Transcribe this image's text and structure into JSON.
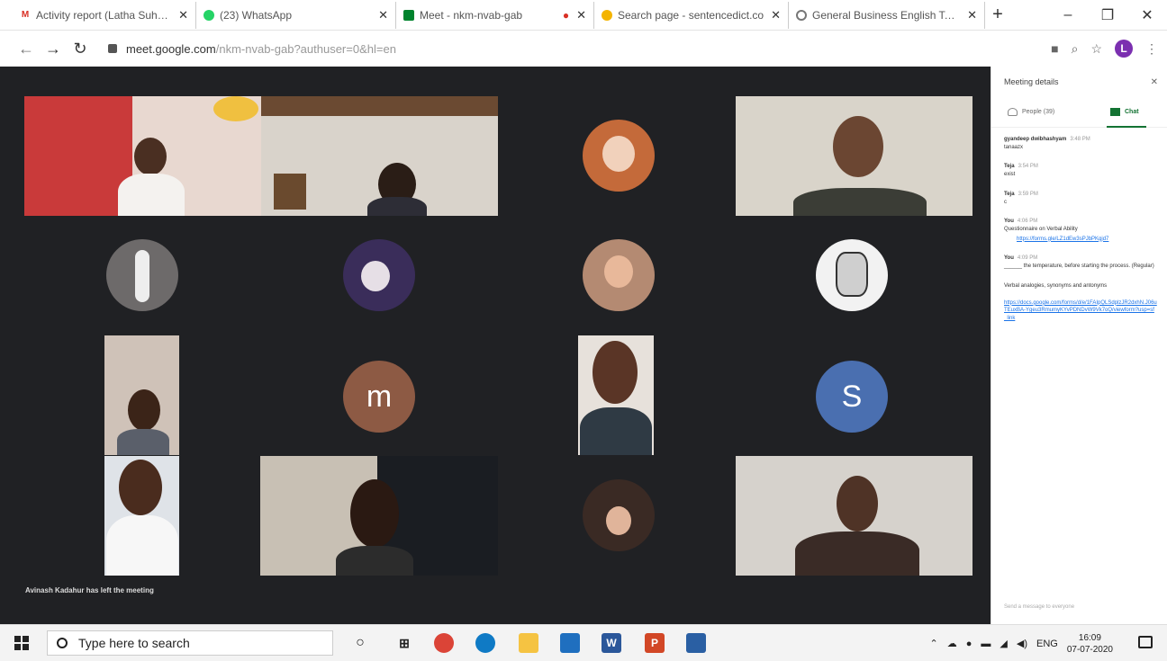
{
  "browser": {
    "tabs": [
      {
        "title": "Activity report (Latha Suhasini",
        "icon": "gmail-icon",
        "color": "#d93025",
        "glyph": "M"
      },
      {
        "title": "(23) WhatsApp",
        "icon": "whatsapp-icon",
        "color": "#25d366",
        "glyph": ""
      },
      {
        "title": "Meet - nkm-nvab-gab",
        "icon": "meet-icon",
        "color": "#00832d",
        "glyph": ""
      },
      {
        "title": "Search page - sentencedict.co",
        "icon": "sentencedict-icon",
        "color": "#f4b400",
        "glyph": ""
      },
      {
        "title": "General Business English Term",
        "icon": "web-icon",
        "color": "#777777",
        "glyph": ""
      }
    ],
    "new_tab": "+",
    "url_host": "meet.google.com",
    "url_path": "/nkm-nvab-gab?authuser=0&hl=en",
    "profile_initial": "L"
  },
  "meet": {
    "toast": "Avinash Kadahur has left the meeting",
    "letters": {
      "m": "m",
      "s": "S"
    },
    "colors": {
      "m": "#8d5a44",
      "s": "#4a6fb0"
    }
  },
  "panel": {
    "title": "Meeting details",
    "people_tab": "People (39)",
    "chat_tab": "Chat",
    "messages": [
      {
        "sender": "gyandeep dwibhashyam",
        "time": "3:48 PM",
        "text": "tanaazx",
        "link": ""
      },
      {
        "sender": "Teja",
        "time": "3:54 PM",
        "text": "exist",
        "link": ""
      },
      {
        "sender": "Teja",
        "time": "3:59 PM",
        "text": "c",
        "link": ""
      },
      {
        "sender": "You",
        "time": "4:06 PM",
        "text": "Questionnaire on Verbal Ability",
        "link": "https://forms.gle/LZ1dEw3sPJbPKgjd7"
      },
      {
        "sender": "You",
        "time": "4:09 PM",
        "text": "______ the temperature, before starting the process. (Regular)",
        "link": ""
      },
      {
        "sender": "",
        "time": "",
        "text": "Verbal analogies, synonyms and antonyms",
        "link": "https://docs.google.com/forms/d/e/1FAIpQLSdplzJR2dxhN.J06uTEuxBA-Ygeu3RmumyKYvPDNDvW9Vk7oQ/viewform?usp=sf_link"
      }
    ],
    "send_placeholder": "Send a message to everyone"
  },
  "taskbar": {
    "search_placeholder": "Type here to search",
    "language": "ENG",
    "time": "16:09",
    "date": "07-07-2020"
  }
}
